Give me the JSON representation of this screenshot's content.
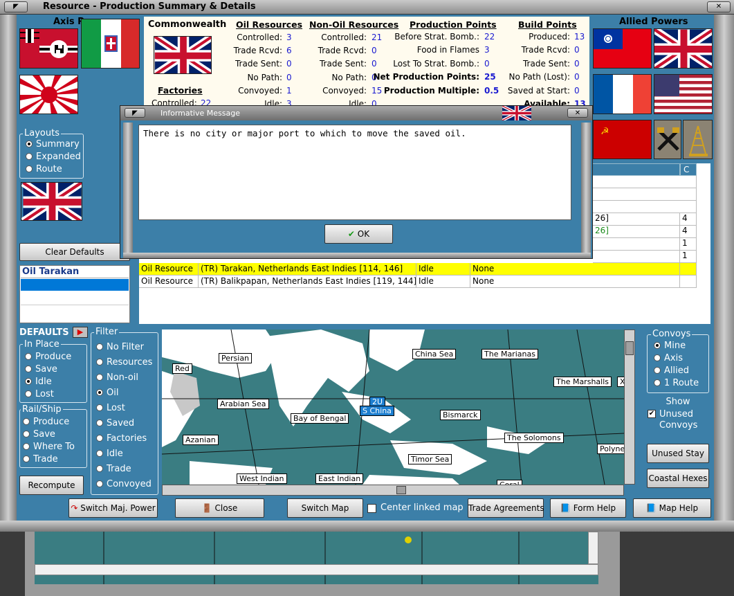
{
  "window": {
    "title": "Resource - Production Summary & Details"
  },
  "axis": {
    "title": "Axis Powers"
  },
  "allied": {
    "title": "Allied Powers"
  },
  "major_power": "Commonwealth",
  "oil_resources": {
    "title": "Oil Resources",
    "rows": [
      {
        "label": "Controlled:",
        "value": "3"
      },
      {
        "label": "Trade Rcvd:",
        "value": "6"
      },
      {
        "label": "Trade Sent:",
        "value": "0"
      },
      {
        "label": "No Path:",
        "value": "0"
      },
      {
        "label": "Convoyed:",
        "value": "1"
      },
      {
        "label": "Idle:",
        "value": "3"
      }
    ]
  },
  "non_oil_resources": {
    "title": "Non-Oil Resources",
    "rows": [
      {
        "label": "Controlled:",
        "value": "21"
      },
      {
        "label": "Trade Rcvd:",
        "value": "0"
      },
      {
        "label": "Trade Sent:",
        "value": "0"
      },
      {
        "label": "No Path:",
        "value": "0"
      },
      {
        "label": "Convoyed:",
        "value": "15"
      },
      {
        "label": "Idle:",
        "value": "0"
      }
    ]
  },
  "production_points": {
    "title": "Production Points",
    "rows": [
      {
        "label": "Before Strat. Bomb.:",
        "value": "22"
      },
      {
        "label": "Food in Flames",
        "value": "3"
      },
      {
        "label": "Lost To Strat. Bomb.:",
        "value": "0"
      },
      {
        "label": "Net Production Points:",
        "value": "25"
      },
      {
        "label": "Production Multiple:",
        "value": "0.5"
      }
    ]
  },
  "build_points": {
    "title": "Build Points",
    "rows": [
      {
        "label": "Produced:",
        "value": "13"
      },
      {
        "label": "Trade Rcvd:",
        "value": "0"
      },
      {
        "label": "Trade Sent:",
        "value": "0"
      },
      {
        "label": "No Path (Lost):",
        "value": "0"
      },
      {
        "label": "Saved at Start:",
        "value": "0"
      },
      {
        "label": "Available:",
        "value": "13"
      }
    ]
  },
  "factories": {
    "title": "Factories",
    "controlled_label": "Controlled:",
    "controlled_value": "22"
  },
  "layouts": {
    "title": "Layouts",
    "options": [
      "Summary",
      "Expanded",
      "Route"
    ],
    "selected": "Summary"
  },
  "clear_defaults": "Clear Defaults",
  "resource_list": {
    "header": "Oil Tarakan"
  },
  "table": {
    "col_c": "C",
    "partial_rows": [
      {
        "text": "26]",
        "c": "4",
        "green": false
      },
      {
        "text": "26]",
        "c": "4",
        "green": true
      },
      {
        "text": "",
        "c": "1",
        "green": false
      },
      {
        "text": "",
        "c": "1",
        "green": false
      }
    ],
    "rows": [
      {
        "type": "Oil Resource",
        "location": "(TR) Tarakan, Netherlands East Indies [114, 146]",
        "status": "Idle",
        "dest": "None",
        "highlight": true
      },
      {
        "type": "Oil Resource",
        "location": "(TR) Balikpapan, Netherlands East Indies [119, 144]",
        "status": "Idle",
        "dest": "None",
        "highlight": false
      }
    ]
  },
  "dialog": {
    "title": "Informative Message",
    "message": "There is no city or major port to which to move the saved oil.",
    "ok": "OK"
  },
  "defaults": {
    "title": "DEFAULTS",
    "in_place": {
      "title": "In Place",
      "options": [
        "Produce",
        "Save",
        "Idle",
        "Lost"
      ],
      "selected": "Idle"
    },
    "rail_ship": {
      "title": "Rail/Ship",
      "options": [
        "Produce",
        "Save",
        "Where To",
        "Trade"
      ]
    }
  },
  "filter": {
    "title": "Filter",
    "options": [
      "No Filter",
      "Resources",
      "Non-oil",
      "Oil",
      "Lost",
      "Saved",
      "Factories",
      "Idle",
      "Trade",
      "Convoyed"
    ],
    "selected": "Oil"
  },
  "recompute": "Recompute",
  "map_labels": [
    "Persian",
    "Red",
    "Arabian Sea",
    "Bay of Bengal",
    "China Sea",
    "The Marianas",
    "The Marshalls",
    "2U",
    "S China",
    "Bismarck",
    "Azanian",
    "The Solomons",
    "Polynes",
    "Timor Sea",
    "West Indian",
    "East Indian",
    "Coral",
    "X"
  ],
  "convoys": {
    "title": "Convoys",
    "options": [
      "Mine",
      "Axis",
      "Allied",
      "1 Route"
    ],
    "selected": "Mine"
  },
  "show_unused": {
    "line1": "Show",
    "line2": "Unused",
    "line3": "Convoys",
    "checked": true
  },
  "unused_stay": "Unused Stay",
  "coastal_hexes": "Coastal Hexes",
  "bottom_buttons": {
    "switch_major": "Switch Maj. Power",
    "close": "Close",
    "switch_map": "Switch Map",
    "center_linked": "Center linked map",
    "trade": "Trade Agreements",
    "form_help": "Form Help",
    "map_help": "Map Help"
  },
  "colors": {
    "panel_blue": "#3c7fa8",
    "highlight_row": "#ffff00",
    "selected_list": "#0078d7",
    "value_blue": "#1a1ad0"
  }
}
